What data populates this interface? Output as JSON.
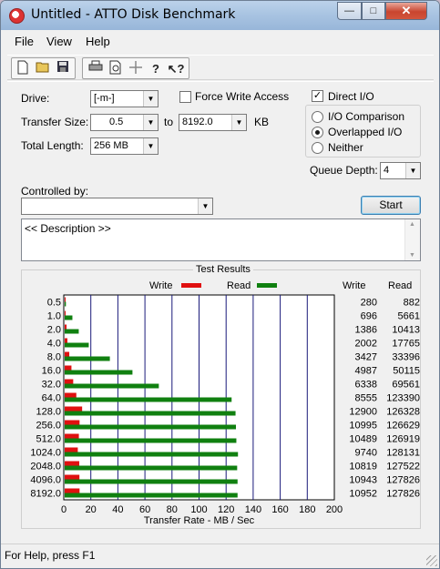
{
  "window": {
    "title": "Untitled - ATTO Disk Benchmark",
    "icon": "atto-app-icon",
    "buttons": {
      "minimize": "—",
      "maximize": "□",
      "close": "✕"
    }
  },
  "menu": [
    "File",
    "View",
    "Help"
  ],
  "toolbar": {
    "icons": [
      "new-icon",
      "open-icon",
      "save-icon",
      "print-icon",
      "print-preview-icon",
      "move-icon",
      "help-icon",
      "context-help-icon"
    ]
  },
  "form": {
    "drive_label": "Drive:",
    "drive_value": "[-m-]",
    "force_write_label": "Force Write Access",
    "force_write_checked": false,
    "direct_io_label": "Direct I/O",
    "direct_io_checked": true,
    "transfer_size_label": "Transfer Size:",
    "transfer_from": "0.5",
    "to_label": "to",
    "transfer_to": "8192.0",
    "kb_label": "KB",
    "total_length_label": "Total Length:",
    "total_length_value": "256 MB",
    "io_options": [
      {
        "label": "I/O Comparison",
        "selected": false
      },
      {
        "label": "Overlapped I/O",
        "selected": true
      },
      {
        "label": "Neither",
        "selected": false
      }
    ],
    "queue_depth_label": "Queue Depth:",
    "queue_depth_value": "4",
    "controlled_by_label": "Controlled by:",
    "controlled_by_value": "",
    "start_label": "Start",
    "description": "<< Description >>"
  },
  "results": {
    "title": "Test Results",
    "legend_write": "Write",
    "legend_read": "Read",
    "col_write": "Write",
    "col_read": "Read",
    "xlabel": "Transfer Rate - MB / Sec",
    "rows": [
      {
        "size": "0.5",
        "write": "280",
        "read": "882"
      },
      {
        "size": "1.0",
        "write": "696",
        "read": "5661"
      },
      {
        "size": "2.0",
        "write": "1386",
        "read": "10413"
      },
      {
        "size": "4.0",
        "write": "2002",
        "read": "17765"
      },
      {
        "size": "8.0",
        "write": "3427",
        "read": "33396"
      },
      {
        "size": "16.0",
        "write": "4987",
        "read": "50115"
      },
      {
        "size": "32.0",
        "write": "6338",
        "read": "69561"
      },
      {
        "size": "64.0",
        "write": "8555",
        "read": "123390"
      },
      {
        "size": "128.0",
        "write": "12900",
        "read": "126328"
      },
      {
        "size": "256.0",
        "write": "10995",
        "read": "126629"
      },
      {
        "size": "512.0",
        "write": "10489",
        "read": "126919"
      },
      {
        "size": "1024.0",
        "write": "9740",
        "read": "128131"
      },
      {
        "size": "2048.0",
        "write": "10819",
        "read": "127522"
      },
      {
        "size": "4096.0",
        "write": "10943",
        "read": "127826"
      },
      {
        "size": "8192.0",
        "write": "10952",
        "read": "127826"
      }
    ]
  },
  "chart_data": {
    "type": "bar",
    "orientation": "horizontal",
    "categories": [
      "0.5",
      "1.0",
      "2.0",
      "4.0",
      "8.0",
      "16.0",
      "32.0",
      "64.0",
      "128.0",
      "256.0",
      "512.0",
      "1024.0",
      "2048.0",
      "4096.0",
      "8192.0"
    ],
    "series": [
      {
        "name": "Write",
        "color": "#e01010",
        "values": [
          0.3,
          0.7,
          1.4,
          2.0,
          3.4,
          5.0,
          6.3,
          8.6,
          12.9,
          11.0,
          10.5,
          9.7,
          10.8,
          10.9,
          11.0
        ]
      },
      {
        "name": "Read",
        "color": "#108010",
        "values": [
          0.9,
          5.7,
          10.4,
          17.8,
          33.4,
          50.1,
          69.6,
          123.4,
          126.3,
          126.6,
          126.9,
          128.1,
          127.5,
          127.8,
          127.8
        ]
      }
    ],
    "xlabel": "Transfer Rate - MB / Sec",
    "xlim": [
      0,
      200
    ],
    "xticks": [
      "0",
      "20",
      "40",
      "60",
      "80",
      "100",
      "120",
      "140",
      "160",
      "180",
      "200"
    ],
    "grid": true,
    "legend": "top"
  },
  "status": {
    "text": "For Help, press F1"
  }
}
